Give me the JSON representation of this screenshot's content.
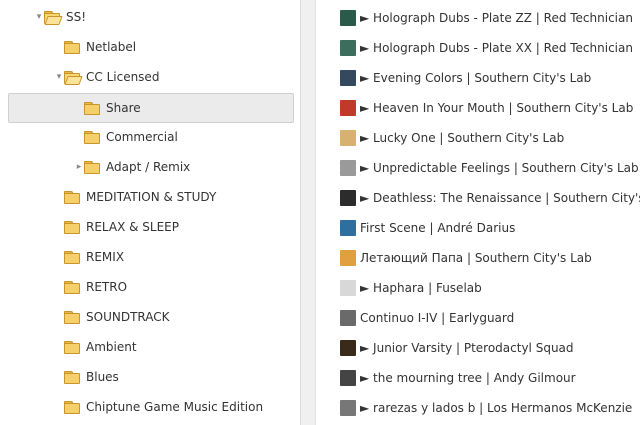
{
  "tree": {
    "items": [
      {
        "label": "SS!",
        "level": 0,
        "twisty": "▾",
        "open": true
      },
      {
        "label": "Netlabel",
        "level": 1,
        "twisty": "",
        "open": false
      },
      {
        "label": "CC Licensed",
        "level": 1,
        "twisty": "▾",
        "open": true
      },
      {
        "label": "Share",
        "level": 2,
        "twisty": "",
        "open": false,
        "selected": true
      },
      {
        "label": "Commercial",
        "level": 2,
        "twisty": "",
        "open": false
      },
      {
        "label": "Adapt / Remix",
        "level": 2,
        "twisty": "▸",
        "open": false
      },
      {
        "label": "MEDITATION & STUDY",
        "level": 1,
        "twisty": "",
        "open": false
      },
      {
        "label": "RELAX & SLEEP",
        "level": 1,
        "twisty": "",
        "open": false
      },
      {
        "label": "REMIX",
        "level": 1,
        "twisty": "",
        "open": false
      },
      {
        "label": "RETRO",
        "level": 1,
        "twisty": "",
        "open": false
      },
      {
        "label": "SOUNDTRACK",
        "level": 1,
        "twisty": "",
        "open": false
      },
      {
        "label": "Ambient",
        "level": 1,
        "twisty": "",
        "open": false
      },
      {
        "label": "Blues",
        "level": 1,
        "twisty": "",
        "open": false
      },
      {
        "label": "Chiptune Game Music Edition",
        "level": 1,
        "twisty": "",
        "open": false
      }
    ]
  },
  "tracks": {
    "items": [
      {
        "label": "► Holograph Dubs - Plate ZZ | Red Technician",
        "color": "#2a5a4a"
      },
      {
        "label": "► Holograph Dubs - Plate XX | Red Technician",
        "color": "#3c6e5e"
      },
      {
        "label": "► Evening Colors | Southern City's Lab",
        "color": "#34495e"
      },
      {
        "label": "► Heaven In Your Mouth | Southern City's Lab",
        "color": "#c0392b"
      },
      {
        "label": "► Lucky One | Southern City's Lab",
        "color": "#d8b070"
      },
      {
        "label": "► Unpredictable Feelings | Southern City's Lab",
        "color": "#9a9a9a"
      },
      {
        "label": "► Deathless: The Renaissance | Southern City's Lab",
        "color": "#2c2c2c"
      },
      {
        "label": "First Scene | André Darius",
        "color": "#2f6f9f"
      },
      {
        "label": "Летающий Папа | Southern City's Lab",
        "color": "#e0a040"
      },
      {
        "label": "► Haphara | Fuselab",
        "color": "#d8d8d8"
      },
      {
        "label": "Continuo I-IV | Earlyguard",
        "color": "#6a6a6a"
      },
      {
        "label": "► Junior Varsity | Pterodactyl Squad",
        "color": "#3a2a1a"
      },
      {
        "label": "► the mourning tree | Andy Gilmour",
        "color": "#444444"
      },
      {
        "label": "► rarezas y lados b | Los Hermanos McKenzie",
        "color": "#777777"
      }
    ]
  }
}
